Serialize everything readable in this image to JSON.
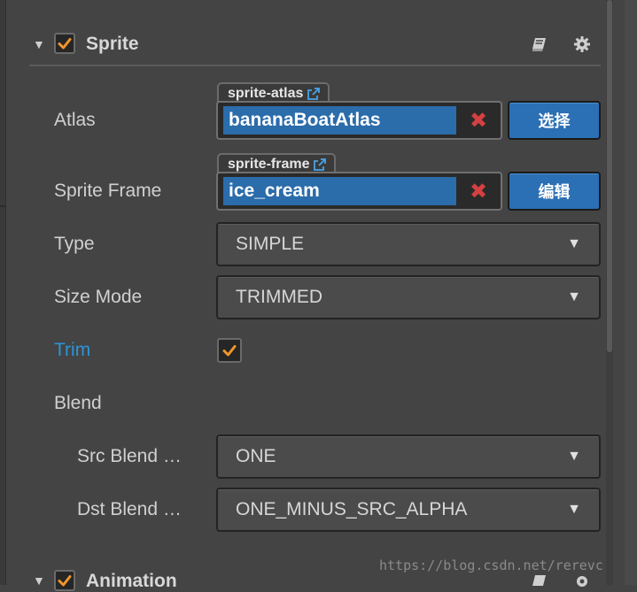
{
  "sprite_component": {
    "title": "Sprite",
    "enabled": true,
    "icons": [
      "book-icon",
      "gear-icon"
    ]
  },
  "properties": {
    "atlas": {
      "label": "Atlas",
      "asset_type": "sprite-atlas",
      "value": "bananaBoatAtlas",
      "clear_symbol": "✖",
      "button_label": "选择"
    },
    "sprite_frame": {
      "label": "Sprite Frame",
      "asset_type": "sprite-frame",
      "value": "ice_cream",
      "clear_symbol": "✖",
      "button_label": "编辑"
    },
    "type": {
      "label": "Type",
      "value": "SIMPLE"
    },
    "size_mode": {
      "label": "Size Mode",
      "value": "TRIMMED"
    },
    "trim": {
      "label": "Trim",
      "checked": true
    },
    "blend": {
      "label": "Blend"
    },
    "src_blend": {
      "label": "Src Blend …",
      "value": "ONE"
    },
    "dst_blend": {
      "label": "Dst Blend …",
      "value": "ONE_MINUS_SRC_ALPHA"
    }
  },
  "animation_component": {
    "title": "Animation",
    "enabled": true
  },
  "watermark": "https://blog.csdn.net/rerevc",
  "colors": {
    "background": "#444444",
    "accent_blue": "#2b6fb4",
    "checkbox_orange": "#f0962c",
    "trim_label_blue": "#2b95d9",
    "clear_red": "#d64040"
  }
}
